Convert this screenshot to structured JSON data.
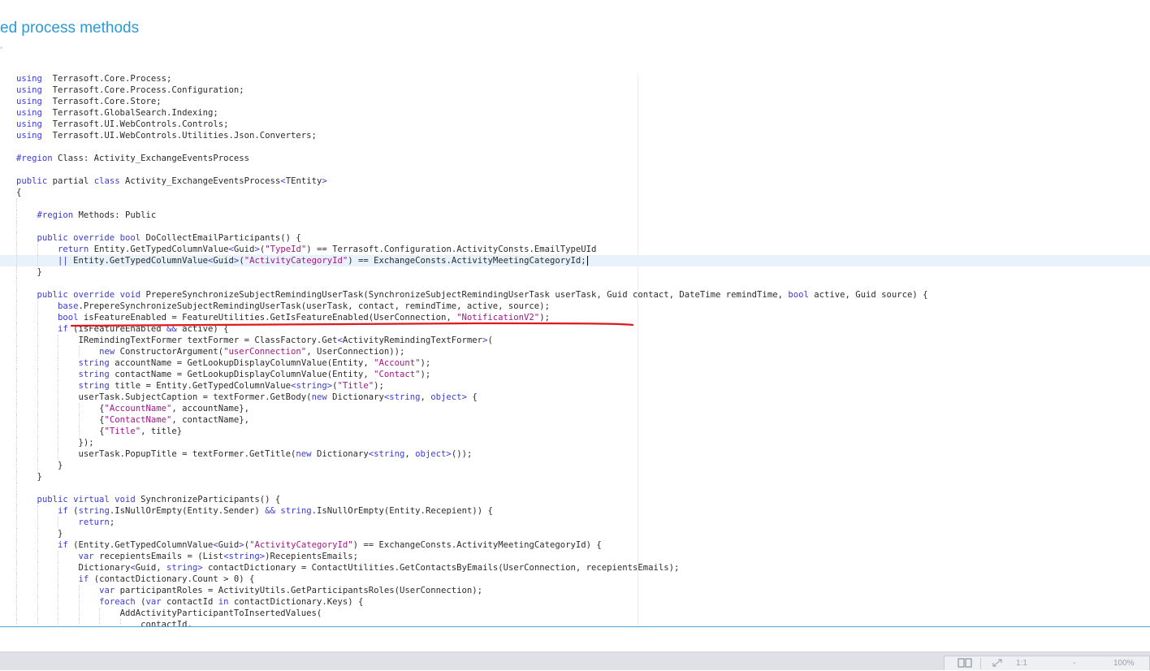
{
  "page": {
    "title": "ed process methods"
  },
  "editor": {
    "active_line": 16,
    "lines": [
      {
        "indent": 0,
        "tokens": [
          [
            "kw",
            "using"
          ],
          [
            "",
            "  Terrasoft.Core.Process;"
          ]
        ]
      },
      {
        "indent": 0,
        "tokens": [
          [
            "kw",
            "using"
          ],
          [
            "",
            "  Terrasoft.Core.Process.Configuration;"
          ]
        ]
      },
      {
        "indent": 0,
        "tokens": [
          [
            "kw",
            "using"
          ],
          [
            "",
            "  Terrasoft.Core.Store;"
          ]
        ]
      },
      {
        "indent": 0,
        "tokens": [
          [
            "kw",
            "using"
          ],
          [
            "",
            "  Terrasoft.GlobalSearch.Indexing;"
          ]
        ]
      },
      {
        "indent": 0,
        "tokens": [
          [
            "kw",
            "using"
          ],
          [
            "",
            "  Terrasoft.UI.WebControls.Controls;"
          ]
        ]
      },
      {
        "indent": 0,
        "tokens": [
          [
            "kw",
            "using"
          ],
          [
            "",
            "  Terrasoft.UI.WebControls.Utilities.Json.Converters;"
          ]
        ]
      },
      {
        "indent": 0,
        "tokens": []
      },
      {
        "indent": 0,
        "tokens": [
          [
            "kw",
            "#region"
          ],
          [
            "",
            " Class: Activity_ExchangeEventsProcess"
          ]
        ]
      },
      {
        "indent": 0,
        "tokens": []
      },
      {
        "indent": 0,
        "tokens": [
          [
            "kw",
            "public"
          ],
          [
            "",
            " partial "
          ],
          [
            "kw",
            "class"
          ],
          [
            "",
            " Activity_ExchangeEventsProcess"
          ],
          [
            "kw",
            "<"
          ],
          [
            "",
            "TEntity"
          ],
          [
            "kw",
            ">"
          ]
        ]
      },
      {
        "indent": 0,
        "tokens": [
          [
            "",
            "{"
          ]
        ]
      },
      {
        "indent": 1,
        "tokens": []
      },
      {
        "indent": 1,
        "tokens": [
          [
            "kw",
            "#region"
          ],
          [
            "",
            " Methods: Public"
          ]
        ]
      },
      {
        "indent": 1,
        "tokens": []
      },
      {
        "indent": 1,
        "tokens": [
          [
            "kw",
            "public override bool"
          ],
          [
            "",
            " DoCollectEmailParticipants() {"
          ]
        ]
      },
      {
        "indent": 2,
        "tokens": [
          [
            "kw",
            "return"
          ],
          [
            "",
            " Entity.GetTypedColumnValue"
          ],
          [
            "kw",
            "<"
          ],
          [
            "",
            "Guid"
          ],
          [
            "kw",
            ">"
          ],
          [
            "",
            "("
          ],
          [
            "str",
            "\"TypeId\""
          ],
          [
            "",
            ") == Terrasoft.Configuration.ActivityConsts.EmailTypeUId"
          ]
        ]
      },
      {
        "indent": 2,
        "tokens": [
          [
            "kw",
            "||"
          ],
          [
            "",
            " Entity.GetTypedColumnValue"
          ],
          [
            "kw",
            "<"
          ],
          [
            "",
            "Guid"
          ],
          [
            "kw",
            ">"
          ],
          [
            "",
            "("
          ],
          [
            "str",
            "\"ActivityCategoryId\""
          ],
          [
            "",
            ") == ExchangeConsts.ActivityMeetingCategoryId;"
          ]
        ],
        "cursor": true
      },
      {
        "indent": 1,
        "tokens": [
          [
            "",
            "}"
          ]
        ]
      },
      {
        "indent": 1,
        "tokens": []
      },
      {
        "indent": 1,
        "tokens": [
          [
            "kw",
            "public override void"
          ],
          [
            "",
            " PrepereSynchronizeSubjectRemindingUserTask(SynchronizeSubjectRemindingUserTask userTask, Guid contact, DateTime remindTime, "
          ],
          [
            "kw",
            "bool"
          ],
          [
            "",
            " active, Guid source) {"
          ]
        ]
      },
      {
        "indent": 2,
        "tokens": [
          [
            "kw",
            "base"
          ],
          [
            "",
            ".PrepereSynchronizeSubjectRemindingUserTask(userTask, contact, remindTime, active, source);"
          ]
        ]
      },
      {
        "indent": 2,
        "tokens": [
          [
            "kw",
            "bool"
          ],
          [
            "",
            " isFeatureEnabled = FeatureUtilities.GetIsFeatureEnabled(UserConnection, "
          ],
          [
            "str",
            "\"NotificationV2\""
          ],
          [
            "",
            ");"
          ]
        ]
      },
      {
        "indent": 2,
        "tokens": [
          [
            "kw",
            "if"
          ],
          [
            "",
            " (isFeatureEnabled "
          ],
          [
            "kw",
            "&&"
          ],
          [
            "",
            " active) {"
          ]
        ]
      },
      {
        "indent": 3,
        "tokens": [
          [
            "",
            "IRemindingTextFormer textFormer = ClassFactory.Get"
          ],
          [
            "kw",
            "<"
          ],
          [
            "",
            "ActivityRemindingTextFormer"
          ],
          [
            "kw",
            ">"
          ],
          [
            "",
            "("
          ]
        ]
      },
      {
        "indent": 4,
        "tokens": [
          [
            "kw",
            "new"
          ],
          [
            "",
            " ConstructorArgument("
          ],
          [
            "str",
            "\"userConnection\""
          ],
          [
            "",
            ", UserConnection));"
          ]
        ]
      },
      {
        "indent": 3,
        "tokens": [
          [
            "kw",
            "string"
          ],
          [
            "",
            " accountName = GetLookupDisplayColumnValue(Entity, "
          ],
          [
            "str",
            "\"Account\""
          ],
          [
            "",
            ");"
          ]
        ]
      },
      {
        "indent": 3,
        "tokens": [
          [
            "kw",
            "string"
          ],
          [
            "",
            " contactName = GetLookupDisplayColumnValue(Entity, "
          ],
          [
            "str",
            "\"Contact\""
          ],
          [
            "",
            ");"
          ]
        ]
      },
      {
        "indent": 3,
        "tokens": [
          [
            "kw",
            "string"
          ],
          [
            "",
            " title = Entity.GetTypedColumnValue"
          ],
          [
            "kw",
            "<string>"
          ],
          [
            "",
            "("
          ],
          [
            "str",
            "\"Title\""
          ],
          [
            "",
            ");"
          ]
        ]
      },
      {
        "indent": 3,
        "tokens": [
          [
            "",
            "userTask.SubjectCaption = textFormer.GetBody("
          ],
          [
            "kw",
            "new"
          ],
          [
            "",
            " Dictionary"
          ],
          [
            "kw",
            "<string"
          ],
          [
            "",
            ", "
          ],
          [
            "kw",
            "object>"
          ],
          [
            "",
            " {"
          ]
        ]
      },
      {
        "indent": 4,
        "tokens": [
          [
            "",
            "{"
          ],
          [
            "str",
            "\"AccountName\""
          ],
          [
            "",
            ", accountName},"
          ]
        ]
      },
      {
        "indent": 4,
        "tokens": [
          [
            "",
            "{"
          ],
          [
            "str",
            "\"ContactName\""
          ],
          [
            "",
            ", contactName},"
          ]
        ]
      },
      {
        "indent": 4,
        "tokens": [
          [
            "",
            "{"
          ],
          [
            "str",
            "\"Title\""
          ],
          [
            "",
            ", title}"
          ]
        ]
      },
      {
        "indent": 3,
        "tokens": [
          [
            "",
            "});"
          ]
        ]
      },
      {
        "indent": 3,
        "tokens": [
          [
            "",
            "userTask.PopupTitle = textFormer.GetTitle("
          ],
          [
            "kw",
            "new"
          ],
          [
            "",
            " Dictionary"
          ],
          [
            "kw",
            "<string"
          ],
          [
            "",
            ", "
          ],
          [
            "kw",
            "object>"
          ],
          [
            "",
            "());"
          ]
        ]
      },
      {
        "indent": 2,
        "tokens": [
          [
            "",
            "}"
          ]
        ]
      },
      {
        "indent": 1,
        "tokens": [
          [
            "",
            "}"
          ]
        ]
      },
      {
        "indent": 1,
        "tokens": []
      },
      {
        "indent": 1,
        "tokens": [
          [
            "kw",
            "public virtual void"
          ],
          [
            "",
            " SynchronizeParticipants() {"
          ]
        ]
      },
      {
        "indent": 2,
        "tokens": [
          [
            "kw",
            "if"
          ],
          [
            "",
            " ("
          ],
          [
            "kw",
            "string"
          ],
          [
            "",
            ".IsNullOrEmpty(Entity.Sender) "
          ],
          [
            "kw",
            "&&"
          ],
          [
            "",
            " "
          ],
          [
            "kw",
            "string"
          ],
          [
            "",
            ".IsNullOrEmpty(Entity.Recepient)) {"
          ]
        ]
      },
      {
        "indent": 3,
        "tokens": [
          [
            "kw",
            "return"
          ],
          [
            "",
            ";"
          ]
        ]
      },
      {
        "indent": 2,
        "tokens": [
          [
            "",
            "}"
          ]
        ]
      },
      {
        "indent": 2,
        "tokens": [
          [
            "kw",
            "if"
          ],
          [
            "",
            " (Entity.GetTypedColumnValue"
          ],
          [
            "kw",
            "<"
          ],
          [
            "",
            "Guid"
          ],
          [
            "kw",
            ">"
          ],
          [
            "",
            "("
          ],
          [
            "str",
            "\"ActivityCategoryId\""
          ],
          [
            "",
            ") == ExchangeConsts.ActivityMeetingCategoryId) {"
          ]
        ]
      },
      {
        "indent": 3,
        "tokens": [
          [
            "kw",
            "var"
          ],
          [
            "",
            " recepientsEmails = (List"
          ],
          [
            "kw",
            "<string>"
          ],
          [
            "",
            ")RecepientsEmails;"
          ]
        ]
      },
      {
        "indent": 3,
        "tokens": [
          [
            "",
            "Dictionary"
          ],
          [
            "kw",
            "<"
          ],
          [
            "",
            "Guid, "
          ],
          [
            "kw",
            "string>"
          ],
          [
            "",
            " contactDictionary = ContactUtilities.GetContactsByEmails(UserConnection, recepientsEmails);"
          ]
        ]
      },
      {
        "indent": 3,
        "tokens": [
          [
            "kw",
            "if"
          ],
          [
            "",
            " (contactDictionary.Count > 0) {"
          ]
        ]
      },
      {
        "indent": 4,
        "tokens": [
          [
            "kw",
            "var"
          ],
          [
            "",
            " participantRoles = ActivityUtils.GetParticipantsRoles(UserConnection);"
          ]
        ]
      },
      {
        "indent": 4,
        "tokens": [
          [
            "kw",
            "foreach"
          ],
          [
            "",
            " ("
          ],
          [
            "kw",
            "var"
          ],
          [
            "",
            " contactId "
          ],
          [
            "kw",
            "in"
          ],
          [
            "",
            " contactDictionary.Keys) {"
          ]
        ]
      },
      {
        "indent": 5,
        "tokens": [
          [
            "",
            "AddActivityParticipantToInsertedValues("
          ]
        ]
      },
      {
        "indent": 6,
        "tokens": [
          [
            "",
            "contactId,"
          ]
        ]
      }
    ]
  },
  "toolbar": {
    "ratio_label": "1:1",
    "minus_label": "-",
    "zoom_label": "100%",
    "icons": [
      "book-icon",
      "expand-icon"
    ]
  },
  "colors": {
    "title": "#2a9ad6",
    "keyword": "#3b3bd6",
    "string": "#a31585",
    "active_line": "#e8f2fb",
    "annotation_underline": "#e0171d",
    "editor_border": "#4aa3df"
  }
}
